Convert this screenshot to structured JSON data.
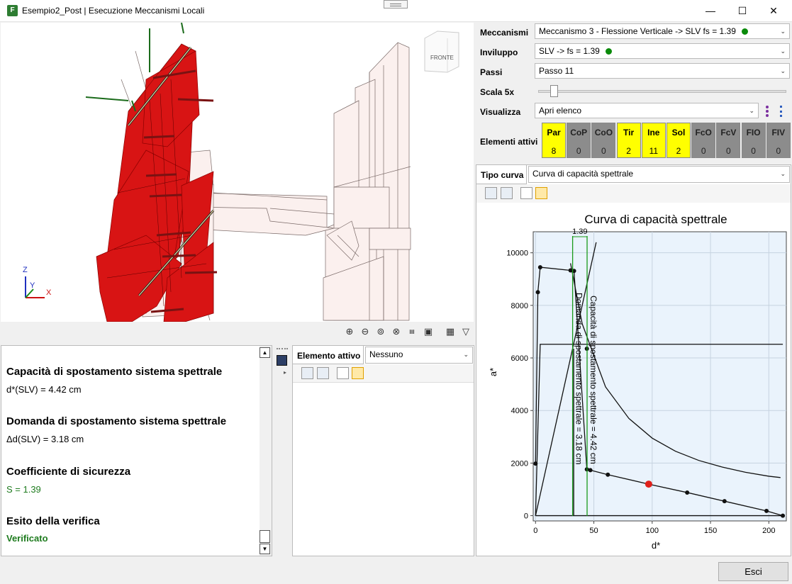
{
  "window": {
    "title": "Esempio2_Post | Esecuzione Meccanismi Locali",
    "app_icon_letter": "F",
    "minimize": "—",
    "maximize": "☐",
    "close": "✕"
  },
  "viewport": {
    "cube_label": "FRONTE",
    "axes": {
      "z": "Z",
      "y": "Y",
      "x": "X"
    },
    "toolbar_icons": [
      "zoom-in-icon",
      "zoom-out-icon",
      "zoom-extents-icon",
      "zoom-window-icon",
      "export-dxf-icon",
      "export-image-icon",
      "view-settings-icon",
      "filter-icon"
    ]
  },
  "controls": {
    "meccanismi_label": "Meccanismi",
    "meccanismi_value": "Meccanismo 3 - Flessione Verticale -> SLV fs = 1.39",
    "inviluppo_label": "Inviluppo",
    "inviluppo_value": "SLV ->  fs = 1.39",
    "passi_label": "Passi",
    "passi_value": "Passo 11",
    "scala_label": "Scala 5x",
    "scala_level": 0.05,
    "visualizza_label": "Visualizza",
    "visualizza_value": "Apri elenco",
    "elementi_label": "Elementi attivi",
    "elementi": [
      {
        "label": "Par",
        "count": "8",
        "active": true
      },
      {
        "label": "CoP",
        "count": "0",
        "active": false
      },
      {
        "label": "CoO",
        "count": "0",
        "active": false
      },
      {
        "label": "Tir",
        "count": "2",
        "active": true
      },
      {
        "label": "Ine",
        "count": "11",
        "active": true
      },
      {
        "label": "Sol",
        "count": "2",
        "active": true
      },
      {
        "label": "FcO",
        "count": "0",
        "active": false
      },
      {
        "label": "FcV",
        "count": "0",
        "active": false
      },
      {
        "label": "FIO",
        "count": "0",
        "active": false
      },
      {
        "label": "FIV",
        "count": "0",
        "active": false
      }
    ]
  },
  "results": {
    "h1": "Capacità di spostamento sistema spettrale",
    "v1": "d*(SLV) = 4.42 cm",
    "h2": "Domanda di spostamento sistema spettrale",
    "v2": "Δd(SLV) = 3.18 cm",
    "h3": "Coefficiente di sicurezza",
    "v3": "S = 1.39",
    "h4": "Esito della verifica",
    "v4": "Verificato"
  },
  "elemento": {
    "tab_label": "Elemento attivo",
    "value": "Nessuno"
  },
  "tipo_curva": {
    "label": "Tipo curva",
    "value": "Curva di capacità spettrale"
  },
  "chart_data": {
    "type": "line",
    "title": "Curva di capacità spettrale",
    "xlabel": "d*",
    "ylabel": "a*",
    "xlim": [
      -2,
      215
    ],
    "ylim": [
      -200,
      10800
    ],
    "xticks": [
      0,
      50,
      100,
      150,
      200
    ],
    "yticks": [
      0,
      2000,
      4000,
      6000,
      8000,
      10000
    ],
    "grid": true,
    "series": [
      {
        "name": "",
        "style": "capacity-curve",
        "x": [
          0,
          2,
          4,
          30,
          33,
          44,
          47,
          62,
          97,
          130,
          162,
          198,
          212
        ],
        "y": [
          1980,
          8500,
          9450,
          9330,
          9310,
          1760,
          1730,
          1560,
          1200,
          880,
          550,
          180,
          0
        ]
      },
      {
        "name": "",
        "style": "bilinear",
        "x": [
          0,
          4,
          44,
          212
        ],
        "y": [
          0,
          6520,
          6520,
          6520
        ]
      },
      {
        "name": "",
        "style": "secant",
        "x": [
          0,
          52
        ],
        "y": [
          0,
          10400
        ]
      },
      {
        "name": "",
        "style": "demand-spectrum",
        "x": [
          30,
          40,
          60,
          80,
          100,
          120,
          140,
          160,
          180,
          200,
          210
        ],
        "y": [
          9600,
          7300,
          4900,
          3700,
          2950,
          2450,
          2100,
          1850,
          1650,
          1500,
          1450
        ]
      }
    ],
    "markers": [
      {
        "x": 0,
        "y": 1980
      },
      {
        "x": 2,
        "y": 8500
      },
      {
        "x": 4,
        "y": 9450
      },
      {
        "x": 30,
        "y": 9330
      },
      {
        "x": 33,
        "y": 9310
      },
      {
        "x": 44,
        "y": 6350
      },
      {
        "x": 44,
        "y": 1760
      },
      {
        "x": 47,
        "y": 1730
      },
      {
        "x": 62,
        "y": 1560
      },
      {
        "x": 130,
        "y": 880
      },
      {
        "x": 162,
        "y": 550
      },
      {
        "x": 198,
        "y": 180
      },
      {
        "x": 212,
        "y": 0
      }
    ],
    "highlight_point": {
      "x": 97,
      "y": 1200,
      "color": "#e0201a"
    },
    "demand_line": {
      "x": 31.8,
      "label": "Domanda di spostamento spettrale = 3.18 cm"
    },
    "capacity_line": {
      "x": 44.2,
      "label": "Capacità di spostamento spettrale = 4.42 cm"
    },
    "factor_label": "1.39",
    "green_color": "#1a9a1a",
    "plot_bg": "#eaf3fc"
  },
  "buttons": {
    "esci": "Esci"
  }
}
